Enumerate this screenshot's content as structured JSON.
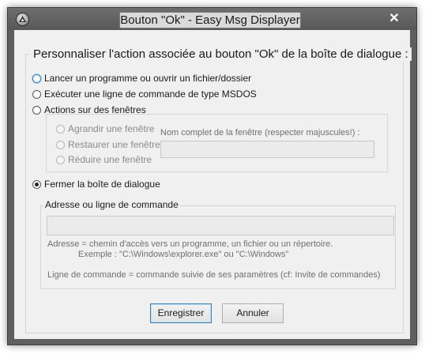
{
  "window": {
    "title": "Bouton \"Ok\" - Easy Msg Displayer",
    "close_glyph": "✕"
  },
  "main": {
    "heading": "Personnaliser l'action associée au bouton \"Ok\" de la boîte de dialogue :",
    "options": [
      {
        "label": "Lancer un programme ou ouvrir un fichier/dossier",
        "selected": false,
        "focused": true
      },
      {
        "label": "Exécuter une ligne de commande de type MSDOS",
        "selected": false
      },
      {
        "label": "Actions sur des fenêtres",
        "selected": false
      },
      {
        "label": "Fermer la boîte de dialogue",
        "selected": true
      }
    ],
    "window_actions": {
      "sub_options": [
        {
          "label": "Agrandir une fenêtre"
        },
        {
          "label": "Restaurer une fenêtre"
        },
        {
          "label": "Réduire une fenêtre"
        }
      ],
      "window_name_label": "Nom complet de la fenêtre (respecter majuscules!) :",
      "window_name_value": ""
    },
    "command_group": {
      "caption": "Adresse ou ligne de commande",
      "value": "",
      "help_address": "Adresse = chemin d'accès vers un programme, un fichier ou un répertoire.",
      "help_example": "Exemple : \"C:\\Windows\\explorer.exe\" ou \"C:\\Windows\"",
      "help_command": "Ligne de commande = commande suivie de ses paramètres (cf: Invite de commandes)"
    },
    "buttons": {
      "save_label": "Enregistrer",
      "cancel_label": "Annuler"
    }
  }
}
